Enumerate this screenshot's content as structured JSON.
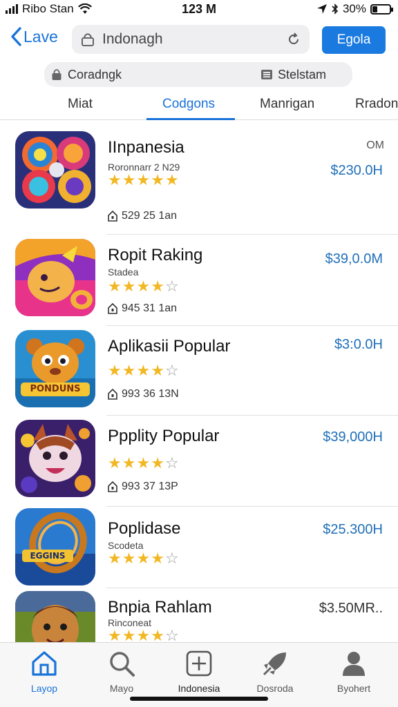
{
  "status": {
    "carrier": "Ribo Stan",
    "time": "123 M",
    "battery_pct": "30%",
    "battery_level": 0.3
  },
  "nav": {
    "back_label": "Lave",
    "search_value": "Indonagh",
    "primary_label": "Egola"
  },
  "filters": {
    "left": "Coradngk",
    "right": "Stelstam"
  },
  "tabs": [
    {
      "label": "Miat"
    },
    {
      "label": "Codgons"
    },
    {
      "label": "Manrigan"
    },
    {
      "label": "Rradon"
    }
  ],
  "apps": [
    {
      "title": "IInpanesia",
      "subtitle": "Roronnarr 2 N29",
      "rating": 5,
      "downloads": "529 25 1an",
      "price": "$230.0H",
      "tag": "OM"
    },
    {
      "title": "Ropit Raking",
      "subtitle": "Stadea",
      "rating": 4,
      "downloads": "945 31 1an",
      "price": "$39,0.0M",
      "tag": ""
    },
    {
      "title": "Aplikasii Popular",
      "subtitle": "",
      "rating": 4,
      "downloads": "993 36 13N",
      "price": "$3:0.0H",
      "tag": "",
      "icon_text": "PONDUNS"
    },
    {
      "title": "Ppplity Popular",
      "subtitle": "",
      "rating": 4,
      "downloads": "993 37 13P",
      "price": "$39,000H",
      "tag": ""
    },
    {
      "title": "Poplidase",
      "subtitle": "Scodeta",
      "rating": 4,
      "downloads": "",
      "price": "$25.300H",
      "tag": "",
      "icon_text": "EGGINS"
    },
    {
      "title": "Bnpia Rahlam",
      "subtitle": "Rinconeat",
      "rating": 4,
      "downloads": "",
      "price": "$3.50MR..",
      "tag": ""
    }
  ],
  "bottom_nav": [
    {
      "label": "Layop",
      "icon": "home-icon"
    },
    {
      "label": "Mayo",
      "icon": "search-icon"
    },
    {
      "label": "Indonesia",
      "icon": "add-icon"
    },
    {
      "label": "Dosroda",
      "icon": "rocket-icon"
    },
    {
      "label": "Byohert",
      "icon": "profile-icon"
    }
  ],
  "colors": {
    "accent": "#1a73d9",
    "star": "#f2b824",
    "price": "#1f6fb8"
  }
}
